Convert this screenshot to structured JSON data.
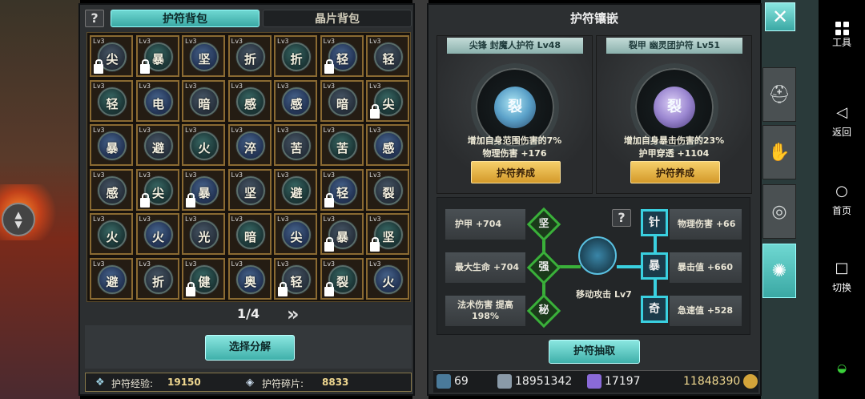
{
  "left_panel": {
    "help": "?",
    "tabs": [
      {
        "label": "护符背包",
        "active": true
      },
      {
        "label": "晶片背包",
        "active": false
      }
    ],
    "grid": [
      [
        {
          "lv": "Lv3",
          "ch": "尖",
          "lock": true
        },
        {
          "lv": "Lv3",
          "ch": "暴",
          "lock": true
        },
        {
          "lv": "Lv3",
          "ch": "坚",
          "lock": false
        },
        {
          "lv": "Lv3",
          "ch": "折",
          "lock": false
        },
        {
          "lv": "Lv3",
          "ch": "折",
          "lock": false
        },
        {
          "lv": "Lv3",
          "ch": "轻",
          "lock": true
        },
        {
          "lv": "Lv3",
          "ch": "轻",
          "lock": false
        }
      ],
      [
        {
          "lv": "Lv3",
          "ch": "轻",
          "lock": false
        },
        {
          "lv": "Lv3",
          "ch": "电",
          "lock": false
        },
        {
          "lv": "Lv3",
          "ch": "暗",
          "lock": false
        },
        {
          "lv": "Lv3",
          "ch": "感",
          "lock": false
        },
        {
          "lv": "Lv3",
          "ch": "感",
          "lock": false
        },
        {
          "lv": "Lv3",
          "ch": "暗",
          "lock": false
        },
        {
          "lv": "Lv3",
          "ch": "尖",
          "lock": true
        }
      ],
      [
        {
          "lv": "Lv3",
          "ch": "暴",
          "lock": false
        },
        {
          "lv": "Lv3",
          "ch": "避",
          "lock": false
        },
        {
          "lv": "Lv3",
          "ch": "火",
          "lock": false
        },
        {
          "lv": "Lv3",
          "ch": "淬",
          "lock": false
        },
        {
          "lv": "Lv3",
          "ch": "苦",
          "lock": false
        },
        {
          "lv": "Lv3",
          "ch": "苦",
          "lock": false
        },
        {
          "lv": "Lv3",
          "ch": "感",
          "lock": false
        }
      ],
      [
        {
          "lv": "Lv3",
          "ch": "感",
          "lock": false
        },
        {
          "lv": "Lv3",
          "ch": "尖",
          "lock": true
        },
        {
          "lv": "Lv3",
          "ch": "暴",
          "lock": true
        },
        {
          "lv": "Lv3",
          "ch": "坚",
          "lock": false
        },
        {
          "lv": "Lv3",
          "ch": "避",
          "lock": false
        },
        {
          "lv": "Lv3",
          "ch": "轻",
          "lock": true
        },
        {
          "lv": "Lv3",
          "ch": "裂",
          "lock": false
        }
      ],
      [
        {
          "lv": "Lv3",
          "ch": "火",
          "lock": false
        },
        {
          "lv": "Lv3",
          "ch": "火",
          "lock": false
        },
        {
          "lv": "Lv3",
          "ch": "光",
          "lock": false
        },
        {
          "lv": "Lv3",
          "ch": "暗",
          "lock": false
        },
        {
          "lv": "Lv3",
          "ch": "尖",
          "lock": false
        },
        {
          "lv": "Lv3",
          "ch": "暴",
          "lock": true
        },
        {
          "lv": "Lv3",
          "ch": "坚",
          "lock": true
        }
      ],
      [
        {
          "lv": "Lv3",
          "ch": "避",
          "lock": false
        },
        {
          "lv": "Lv3",
          "ch": "折",
          "lock": false
        },
        {
          "lv": "Lv3",
          "ch": "健",
          "lock": true
        },
        {
          "lv": "Lv3",
          "ch": "奥",
          "lock": false
        },
        {
          "lv": "Lv3",
          "ch": "轻",
          "lock": true
        },
        {
          "lv": "Lv3",
          "ch": "裂",
          "lock": true
        },
        {
          "lv": "Lv3",
          "ch": "火",
          "lock": false
        }
      ]
    ],
    "pager": "1/4",
    "next_glyph": "»",
    "decompose_button": "选择分解",
    "exp_label": "护符经验:",
    "exp_value": "19150",
    "shard_label": "护符碎片:",
    "shard_value": "8833"
  },
  "right_panel": {
    "title": "护符镶嵌",
    "cards": [
      {
        "name": "尖锋 封魔人护符 Lv48",
        "core": "裂",
        "desc1": "增加自身范围伤害的7%",
        "desc2": "物理伤害 +176",
        "button": "护符养成"
      },
      {
        "name": "裂甲 幽灵团护符 Lv51",
        "core": "裂",
        "desc1": "增加自身暴击伤害的23%",
        "desc2": "护甲穿透 +1104",
        "button": "护符养成"
      }
    ],
    "help": "?",
    "left_stats": [
      "护甲 +704",
      "最大生命 +704",
      "法术伤害 提高\n198%"
    ],
    "left_gems": [
      "坚",
      "强",
      "秘"
    ],
    "right_stats": [
      "物理伤害 +66",
      "暴击值 +660",
      "急速值 +528"
    ],
    "right_gems": [
      "针",
      "暴",
      "奇"
    ],
    "hub_label": "移动攻击 Lv7",
    "extract_button": "护符抽取",
    "currencies": {
      "c1": "69",
      "c2": "18951342",
      "c3": "17197",
      "c4": "11848390"
    }
  },
  "close_glyph": "✕",
  "side_tabs": [
    "helmet-tab",
    "gloves-tab",
    "shield-tab",
    "amulet-tab"
  ],
  "navbar": {
    "tools": "工具",
    "back": "返回",
    "home": "首页",
    "switch": "切换"
  },
  "colors": {
    "accent_teal": "#4fc4be",
    "gold_button": "#e6b44a"
  }
}
